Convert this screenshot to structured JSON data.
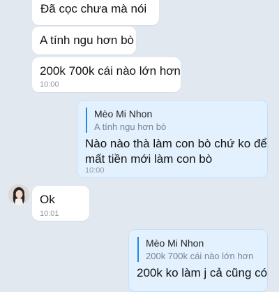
{
  "messages": [
    {
      "text": "Đã cọc chưa mà nói"
    },
    {
      "text": "A tính ngu hơn bò"
    },
    {
      "text": "200k 700k cái nào lớn hơn",
      "time": "10:00"
    },
    {
      "quote_author": "Mèo Mi Nhon",
      "quote_text": "A tính ngu hơn bò",
      "text_line1": "Nào nào thà làm con bò chứ ko để",
      "text_line2": "mất tiền mới làm con bò",
      "time": "10:00"
    },
    {
      "text": "Ok",
      "time": "10:01"
    },
    {
      "quote_author": "Mèo Mi Nhon",
      "quote_text": "200k 700k cái nào lớn hơn",
      "text": "200k ko làm j cả cũng có"
    }
  ],
  "colors": {
    "background": "#e2e8f0",
    "incoming_bubble": "#ffffff",
    "outgoing_bubble": "#e3f1fe",
    "quote_bar": "#1e88e5",
    "timestamp": "#8f98a3"
  },
  "avatar_icon": "user-avatar-photo"
}
